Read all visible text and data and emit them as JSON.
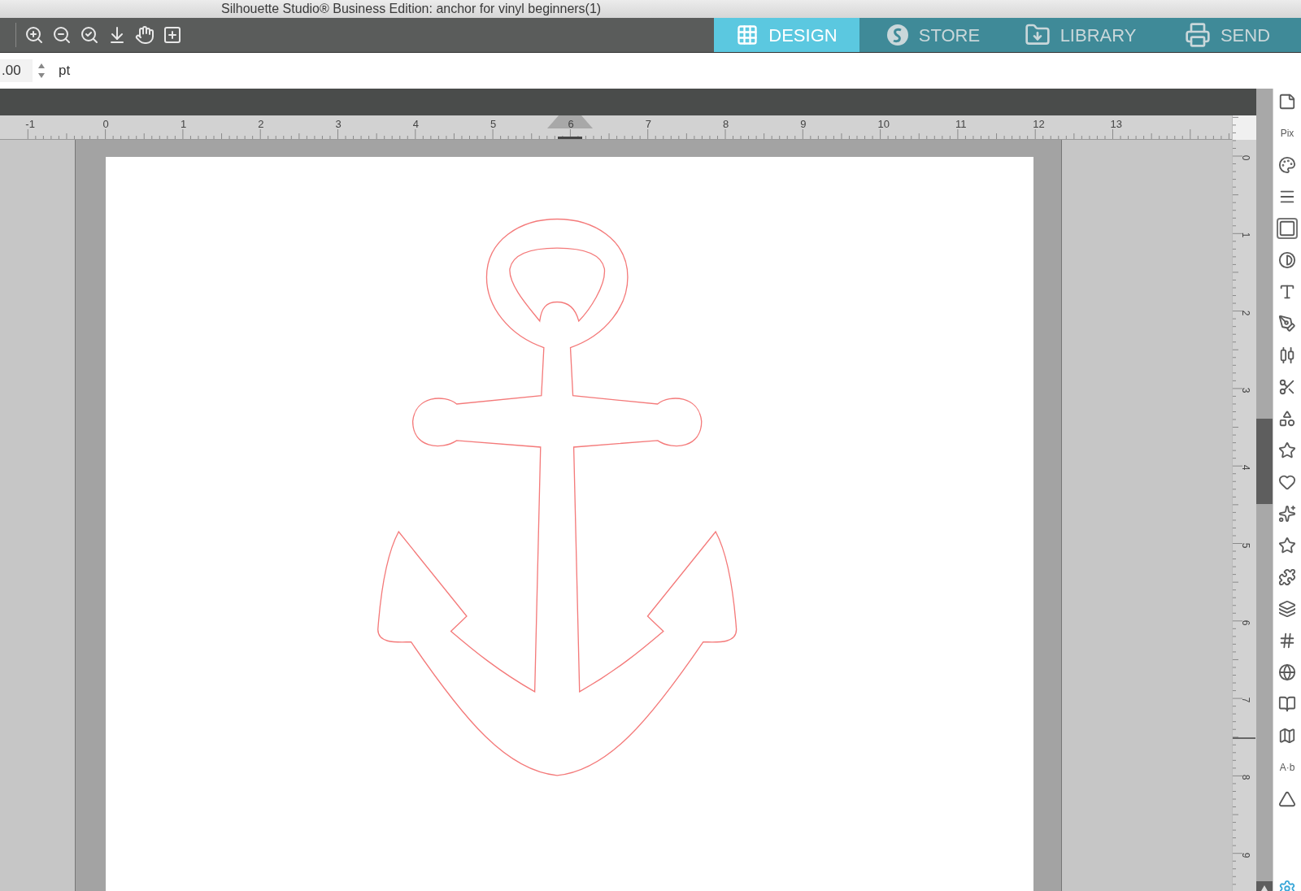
{
  "window": {
    "title": "Silhouette Studio® Business Edition: anchor for vinyl beginners(1)"
  },
  "tabs": [
    {
      "label": "DESIGN",
      "selected": true
    },
    {
      "label": "STORE",
      "selected": false
    },
    {
      "label": "LIBRARY",
      "selected": false
    },
    {
      "label": "SEND",
      "selected": false
    }
  ],
  "options": {
    "value": ".00",
    "unit": "pt"
  },
  "horizontal_ruler": {
    "labels": [
      "-1",
      "0",
      "1",
      "2",
      "3",
      "4",
      "5",
      "6",
      "7",
      "8",
      "9",
      "10",
      "11",
      "12",
      "13"
    ]
  },
  "vertical_ruler": {
    "labels": [
      "0",
      "1",
      "2",
      "3",
      "4",
      "5",
      "6",
      "7",
      "8",
      "9"
    ]
  },
  "side_panel": [
    {
      "kind": "icon",
      "selected": false
    },
    {
      "kind": "text",
      "label": "Pix",
      "selected": false
    },
    {
      "kind": "icon",
      "selected": false
    },
    {
      "kind": "icon",
      "selected": false
    },
    {
      "kind": "icon",
      "selected": true
    },
    {
      "kind": "icon",
      "selected": false
    },
    {
      "kind": "icon",
      "selected": false
    },
    {
      "kind": "icon",
      "selected": false
    },
    {
      "kind": "icon",
      "selected": false
    },
    {
      "kind": "icon",
      "selected": false
    },
    {
      "kind": "icon",
      "selected": false
    },
    {
      "kind": "icon",
      "selected": false
    },
    {
      "kind": "icon",
      "selected": false
    },
    {
      "kind": "icon",
      "selected": false
    },
    {
      "kind": "icon",
      "selected": false
    },
    {
      "kind": "icon",
      "selected": false
    },
    {
      "kind": "icon",
      "selected": false
    },
    {
      "kind": "icon",
      "selected": false
    },
    {
      "kind": "icon",
      "selected": false
    },
    {
      "kind": "icon",
      "selected": false
    },
    {
      "kind": "icon",
      "selected": false
    },
    {
      "kind": "text",
      "label": "A·b",
      "selected": false
    },
    {
      "kind": "icon",
      "selected": false
    }
  ]
}
